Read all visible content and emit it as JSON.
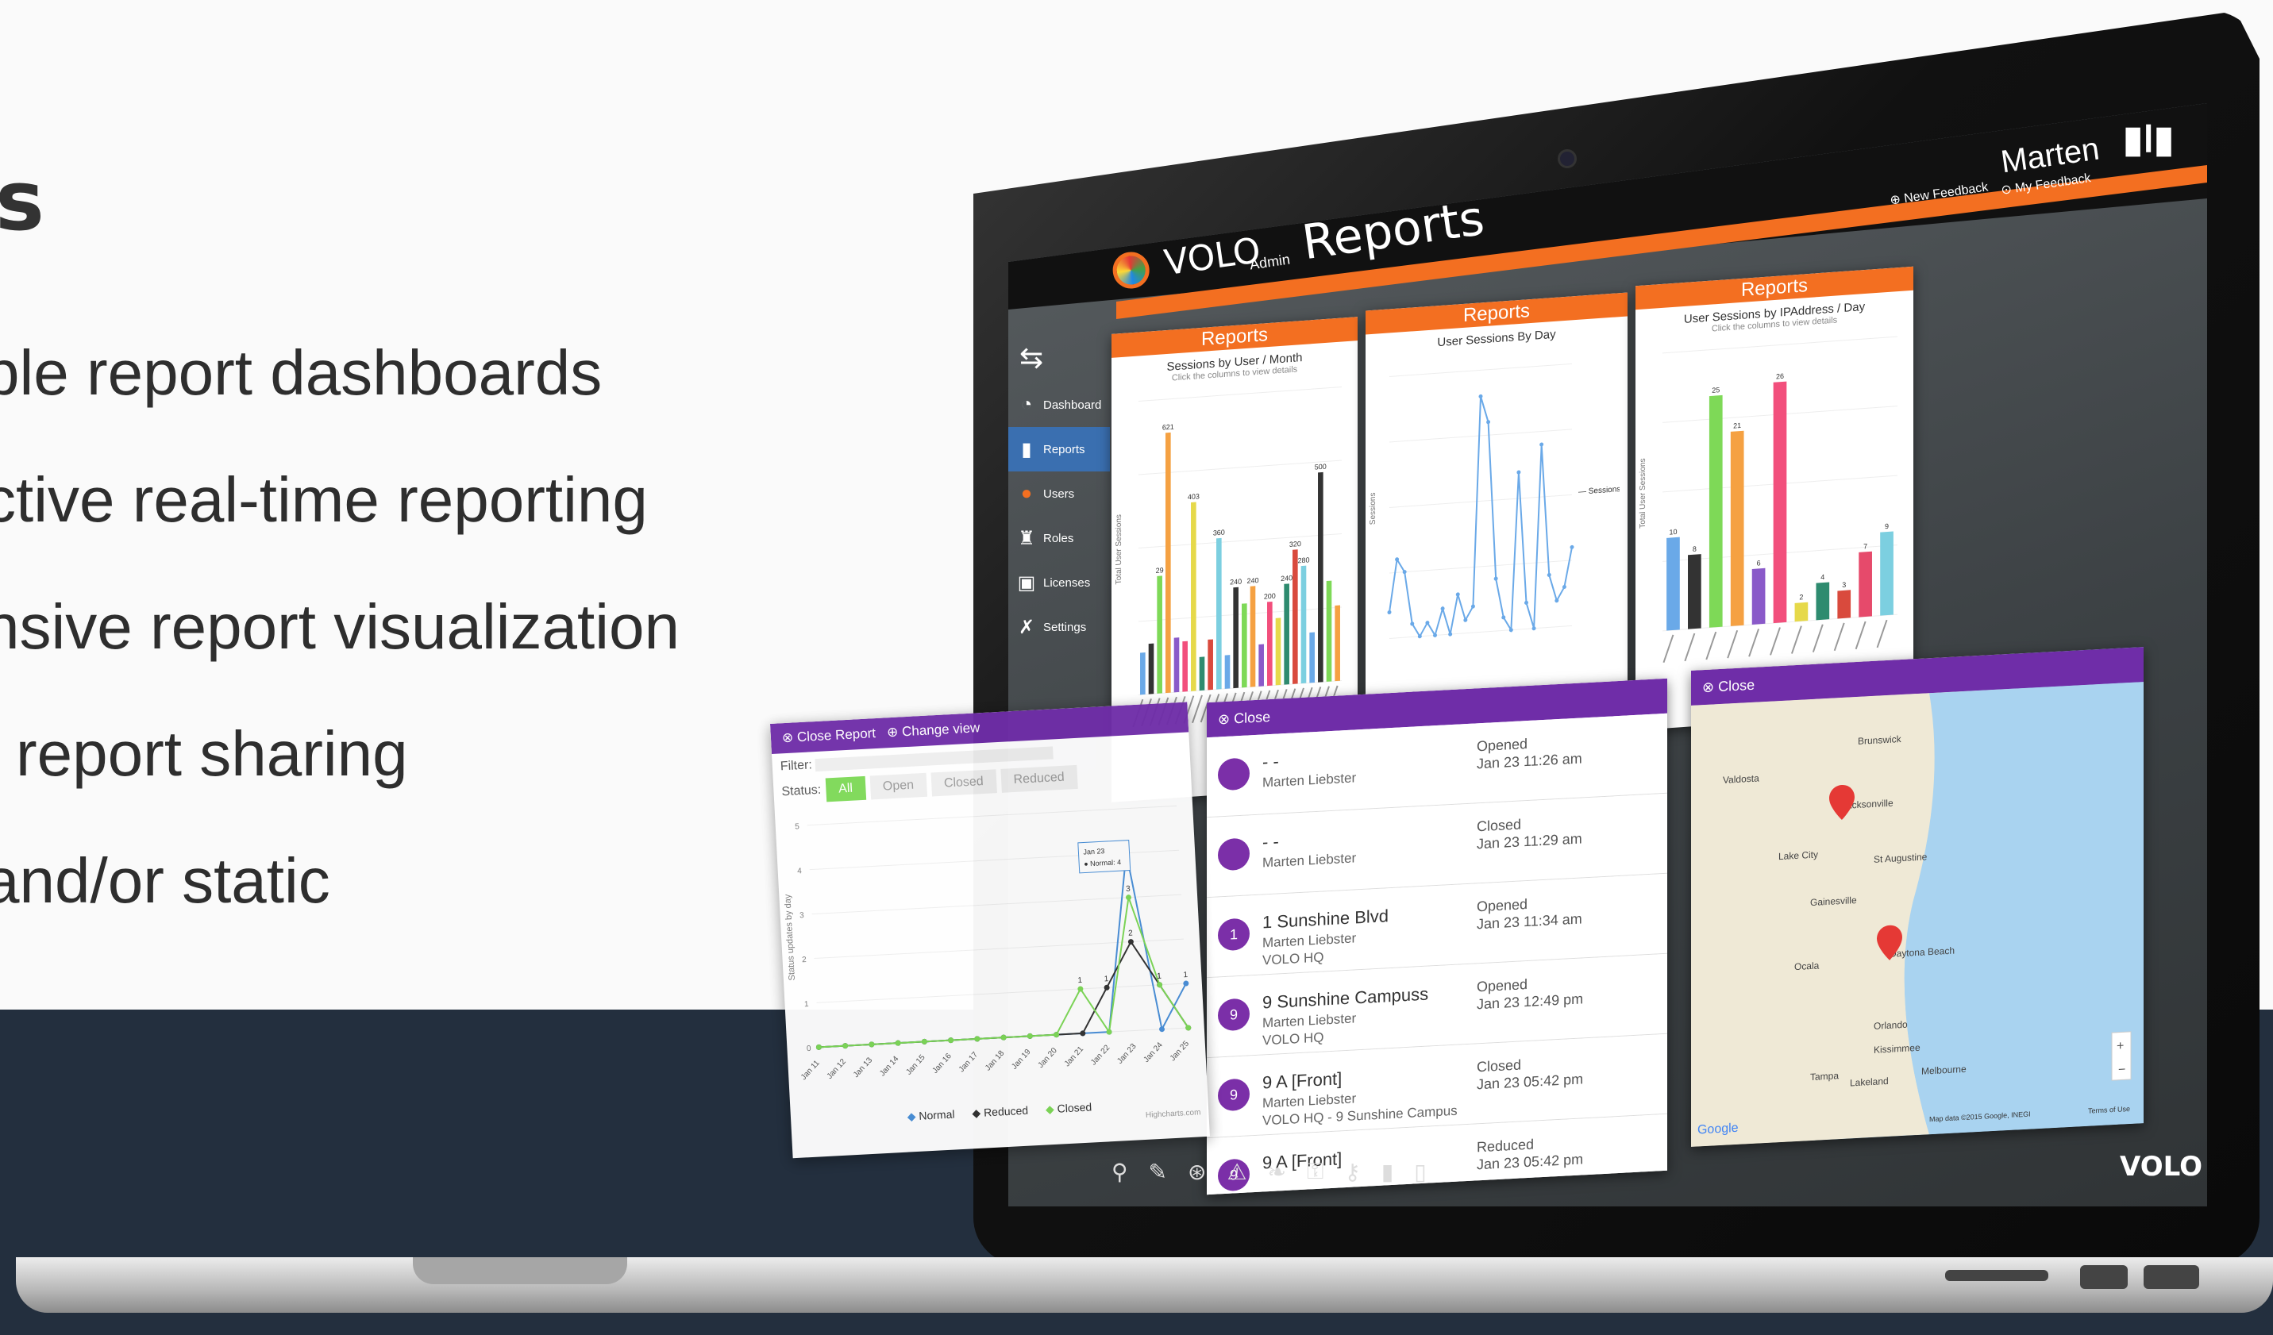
{
  "heading": "s",
  "features": [
    "ble report dashboards",
    "ctive real-time reporting",
    "nsive report visualization",
    "l report sharing",
    "and/or static"
  ],
  "app": {
    "brand": "VOLO",
    "admin_label": "Admin",
    "page_title": "Reports",
    "user_name": "Marten",
    "new_feedback": "New Feedback",
    "my_feedback": "My Feedback",
    "bottom_brand": "VOLO"
  },
  "sidebar": {
    "items": [
      {
        "label": "Dashboard",
        "icon": "speedometer-icon"
      },
      {
        "label": "Reports",
        "icon": "bar-chart-icon"
      },
      {
        "label": "Users",
        "icon": "user-icon"
      },
      {
        "label": "Roles",
        "icon": "role-icon"
      },
      {
        "label": "Licenses",
        "icon": "license-icon"
      },
      {
        "label": "Settings",
        "icon": "wrench-icon"
      }
    ]
  },
  "panels": [
    {
      "header": "Reports",
      "title": "Sessions by User / Month",
      "subtitle": "Click the columns to view details"
    },
    {
      "header": "Reports",
      "title": "User Sessions By Day",
      "subtitle": ""
    },
    {
      "header": "Reports",
      "title": "User Sessions by IPAddress / Day",
      "subtitle": "Click the columns to view details"
    }
  ],
  "chart_data": [
    {
      "type": "bar",
      "title": "Sessions by User / Month",
      "ylabel": "Total User Sessions",
      "values": [
        10,
        12,
        28,
        62,
        13,
        12,
        45,
        8,
        12,
        36,
        8,
        24,
        20,
        24,
        10,
        20,
        16,
        24,
        32,
        28,
        12,
        50,
        24,
        18
      ],
      "colors": [
        "#6aa9e8",
        "#333333",
        "#7ed957",
        "#f5a142",
        "#8a5ac9",
        "#f24f7c",
        "#e6d94a",
        "#2e8b6f",
        "#d94a3d",
        "#7ccfe0",
        "#6aa9e8",
        "#333333",
        "#7ed957",
        "#f5a142",
        "#8a5ac9",
        "#f24f7c",
        "#e6d94a",
        "#2e8b6f",
        "#d94a3d",
        "#7ccfe0",
        "#6aa9e8",
        "#333333",
        "#7ed957",
        "#f5a142"
      ],
      "data_labels": [
        "",
        "",
        "29",
        "621",
        "",
        "",
        "403",
        "",
        "",
        "360",
        "",
        "240",
        "",
        "240",
        "",
        "200",
        "",
        "240",
        "320",
        "280",
        "",
        "500",
        "",
        ""
      ],
      "ylim": [
        0,
        70
      ]
    },
    {
      "type": "line",
      "title": "User Sessions By Day",
      "ylabel": "Sessions",
      "series": [
        {
          "name": "Sessions",
          "values": [
            2,
            6,
            5,
            1,
            0,
            1,
            0,
            2,
            0,
            3,
            1,
            2,
            18,
            16,
            4,
            1,
            0,
            12,
            2,
            0,
            14,
            4,
            2,
            3,
            6
          ]
        }
      ],
      "ylim": [
        0,
        20
      ]
    },
    {
      "type": "bar",
      "title": "User Sessions by IPAddress / Day",
      "ylabel": "Total User Sessions",
      "values": [
        10,
        8,
        25,
        21,
        6,
        26,
        2,
        4,
        3,
        7,
        9
      ],
      "colors": [
        "#6aa9e8",
        "#333333",
        "#7ed957",
        "#f5a142",
        "#8a5ac9",
        "#f24f7c",
        "#e6d94a",
        "#2e8b6f",
        "#d94a3d",
        "#e64a6b",
        "#7ccfe0"
      ],
      "data_labels": [
        "10",
        "8",
        "25",
        "21",
        "6",
        "26",
        "2",
        "4",
        "3",
        "7",
        "9"
      ],
      "ylim": [
        0,
        30
      ]
    },
    {
      "type": "line",
      "title": "",
      "ylabel": "Status updates by day",
      "x": [
        "Jan 11",
        "Jan 12",
        "Jan 13",
        "Jan 14",
        "Jan 15",
        "Jan 16",
        "Jan 17",
        "Jan 18",
        "Jan 19",
        "Jan 20",
        "Jan 21",
        "Jan 22",
        "Jan 23",
        "Jan 24",
        "Jan 25"
      ],
      "series": [
        {
          "name": "Normal",
          "values": [
            0,
            0,
            0,
            0,
            0,
            0,
            0,
            0,
            0,
            0,
            0,
            0,
            4,
            0,
            1
          ]
        },
        {
          "name": "Reduced",
          "values": [
            0,
            0,
            0,
            0,
            0,
            0,
            0,
            0,
            0,
            0,
            0,
            1,
            2,
            1,
            0
          ]
        },
        {
          "name": "Closed",
          "values": [
            0,
            0,
            0,
            0,
            0,
            0,
            0,
            0,
            0,
            0,
            1,
            0,
            3,
            1,
            0
          ]
        }
      ],
      "tooltip": {
        "date": "Jan 23",
        "label": "Normal: 4"
      },
      "ylim": [
        0,
        5
      ]
    }
  ],
  "report_window": {
    "close_label": "Close Report",
    "change_view_label": "Change view",
    "filter_label": "Filter:",
    "status_label": "Status:",
    "status_buttons": [
      "All",
      "Open",
      "Closed",
      "Reduced"
    ],
    "credits": "Highcharts.com"
  },
  "list_panel": {
    "close_label": "Close",
    "rows": [
      {
        "badge": "",
        "title": "- -",
        "sub": "Marten Liebster",
        "status": "Opened",
        "time": "Jan 23 11:26 am"
      },
      {
        "badge": "",
        "title": "- -",
        "sub": "Marten Liebster",
        "status": "Closed",
        "time": "Jan 23 11:29 am"
      },
      {
        "badge": "1",
        "title": "1 Sunshine Blvd",
        "sub": "Marten Liebster\nVOLO HQ",
        "status": "Opened",
        "time": "Jan 23 11:34 am"
      },
      {
        "badge": "9",
        "title": "9 Sunshine Campuss",
        "sub": "Marten Liebster\nVOLO HQ",
        "status": "Opened",
        "time": "Jan 23 12:49 pm"
      },
      {
        "badge": "9",
        "title": "9 A [Front]",
        "sub": "Marten Liebster\nVOLO HQ - 9 Sunshine Campus",
        "status": "Closed",
        "time": "Jan 23 05:42 pm"
      },
      {
        "badge": "9",
        "title": "9 A [Front]",
        "sub": "",
        "status": "Reduced",
        "time": "Jan 23 05:42 pm"
      }
    ]
  },
  "map_panel": {
    "close_label": "Close",
    "cities": [
      "Brunswick",
      "Valdosta",
      "Jacksonville",
      "Lake City",
      "St Augustine",
      "Gainesville",
      "Daytona Beach",
      "Ocala",
      "Orlando",
      "Kissimmee",
      "Melbourne",
      "Tampa",
      "Lakeland"
    ],
    "attribution": "Map data ©2015 Google, INEGI",
    "terms": "Terms of Use",
    "google": "Google"
  }
}
